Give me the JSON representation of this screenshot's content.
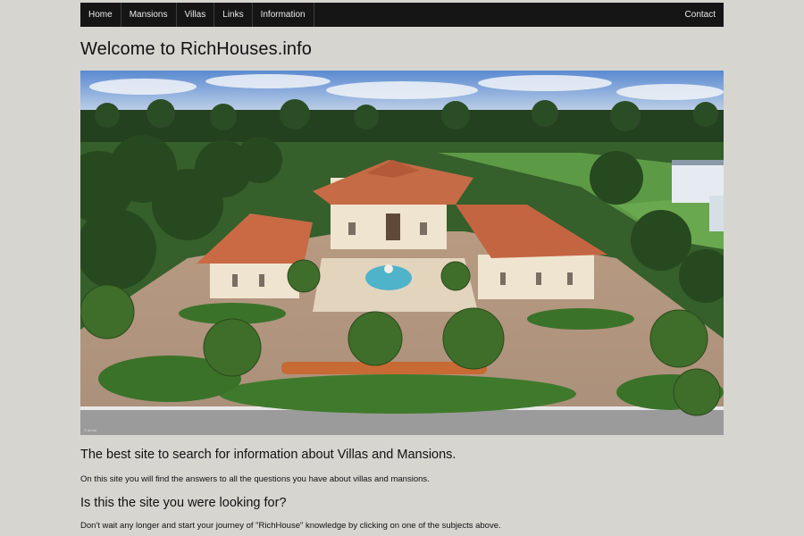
{
  "nav": {
    "items": [
      {
        "key": "home",
        "label": "Home"
      },
      {
        "key": "mansions",
        "label": "Mansions"
      },
      {
        "key": "villas",
        "label": "Villas"
      },
      {
        "key": "links",
        "label": "Links"
      },
      {
        "key": "information",
        "label": "Information"
      }
    ],
    "contact": "Contact"
  },
  "page": {
    "title": "Welcome to RichHouses.info",
    "heading1": "The best site to search for information about Villas and Mansions.",
    "text1": "On this site you will find the answers to all the questions you have about villas and mansions.",
    "heading2": "Is this the site you were looking for?",
    "text2": "Don't wait any longer and start your journey of \"RichHouse\" knowledge by clicking on one of the subjects above."
  },
  "hero": {
    "image": "aerial-mansion-photo"
  }
}
